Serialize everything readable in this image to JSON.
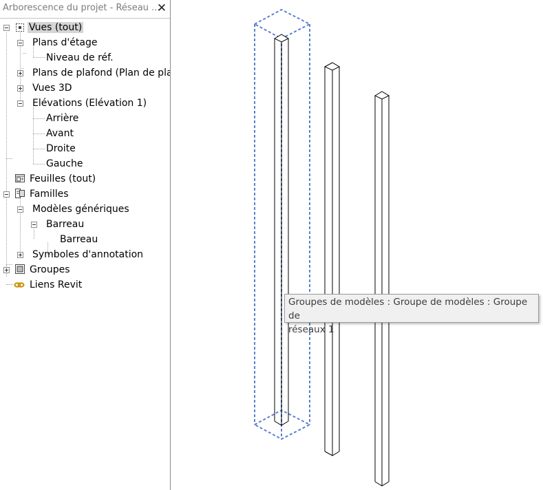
{
  "browser": {
    "title": "Arborescence du projet - Réseau ...",
    "close_glyph": "✕",
    "tree": {
      "views": {
        "label": "Vues (tout)",
        "icon": "views-icon"
      },
      "floor_plans": {
        "label": "Plans d'étage"
      },
      "ref_level": {
        "label": "Niveau de réf."
      },
      "ceiling_plans": {
        "label": "Plans de plafond (Plan de pla"
      },
      "views_3d": {
        "label": "Vues 3D"
      },
      "elevations": {
        "label": "Elévations (Elévation 1)"
      },
      "elev_back": {
        "label": "Arrière"
      },
      "elev_front": {
        "label": "Avant"
      },
      "elev_right": {
        "label": "Droite"
      },
      "elev_left": {
        "label": "Gauche"
      },
      "sheets": {
        "label": "Feuilles (tout)",
        "icon": "sheets-icon"
      },
      "families": {
        "label": "Familles",
        "icon": "families-icon"
      },
      "generic_models": {
        "label": "Modèles génériques"
      },
      "barreau_family": {
        "label": "Barreau"
      },
      "barreau_type": {
        "label": "Barreau"
      },
      "annotation_symbols": {
        "label": "Symboles d'annotation"
      },
      "groups": {
        "label": "Groupes",
        "icon": "groups-icon"
      },
      "revit_links": {
        "label": "Liens Revit",
        "icon": "revit-links-icon"
      }
    }
  },
  "canvas": {
    "tooltip_line1": "Groupes de modèles : Groupe de modèles : Groupe de",
    "tooltip_line2": "réseaux 1",
    "colors": {
      "selection": "#5b7fd0",
      "model_lines": "#000000"
    }
  }
}
